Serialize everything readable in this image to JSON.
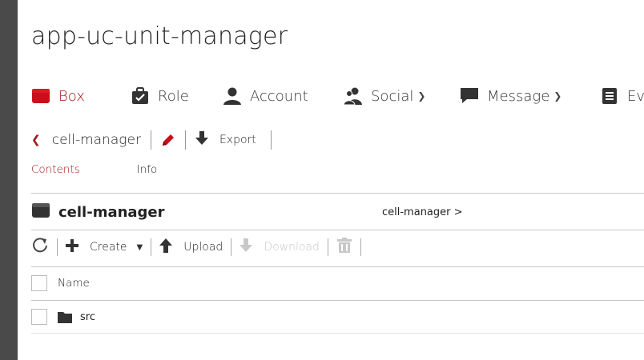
{
  "app": {
    "title": "app-uc-unit-manager"
  },
  "nav": {
    "items": [
      {
        "label": "Box",
        "icon": "box-icon",
        "active": true
      },
      {
        "label": "Role",
        "icon": "role-icon"
      },
      {
        "label": "Account",
        "icon": "account-icon"
      },
      {
        "label": "Social",
        "icon": "social-icon",
        "dropdown": true
      },
      {
        "label": "Message",
        "icon": "message-icon",
        "dropdown": true
      },
      {
        "label": "Eve",
        "icon": "event-icon"
      }
    ]
  },
  "toolbar": {
    "cell_name": "cell-manager",
    "export_label": "Export"
  },
  "tabs": {
    "contents": "Contents",
    "info": "Info"
  },
  "box": {
    "name": "cell-manager",
    "path": "cell-manager >"
  },
  "file_toolbar": {
    "create": "Create",
    "upload": "Upload",
    "download": "Download"
  },
  "table": {
    "header": "Name",
    "rows": [
      {
        "name": "src",
        "type": "folder"
      }
    ]
  },
  "colors": {
    "accent": "#a01414",
    "sidebar": "#4a4a4a",
    "divider": "#c8c8c8"
  }
}
